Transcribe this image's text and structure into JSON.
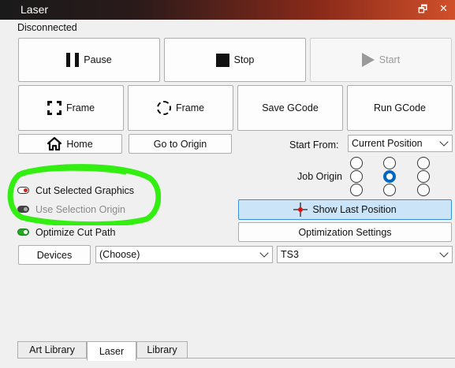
{
  "window": {
    "title": "Laser"
  },
  "status": "Disconnected",
  "row1": {
    "pause": "Pause",
    "stop": "Stop",
    "start": "Start"
  },
  "row2": {
    "frame1": "Frame",
    "frame2": "Frame",
    "save": "Save GCode",
    "run": "Run GCode"
  },
  "row3": {
    "home": "Home",
    "goto_origin": "Go to Origin",
    "start_from_label": "Start From:",
    "start_from_value": "Current Position"
  },
  "job_origin": {
    "label": "Job Origin",
    "selected": "middle-center"
  },
  "options": {
    "cut_selected": "Cut Selected Graphics",
    "use_selection_origin": "Use Selection Origin",
    "optimize_cut_path": "Optimize Cut Path"
  },
  "show_last_position": "Show Last Position",
  "optimization_settings": "Optimization Settings",
  "devices": {
    "button": "Devices",
    "choose_value": "(Choose)",
    "profile_value": "TS3"
  },
  "tabs": [
    "Art Library",
    "Laser",
    "Library"
  ],
  "colors": {
    "annotation": "#33ee11",
    "toggle_red": "#cc2222",
    "toggle_green": "#22aa22",
    "radio_selected": "#0067c0"
  }
}
